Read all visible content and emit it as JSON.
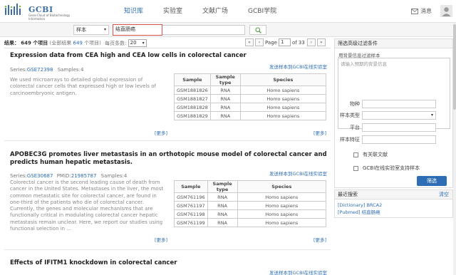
{
  "header": {
    "logo_title": "GCBI",
    "logo_sub": "Gene-Cloud of Biotechnology Information",
    "nav": [
      "知识库",
      "实验室",
      "文献广场",
      "GCBI学院"
    ],
    "active_nav": 0,
    "messages_label": "消息"
  },
  "search": {
    "type_value": "样本",
    "query": "结直肠癌"
  },
  "results": {
    "label": "结果：",
    "count_text": "649 个项目",
    "total_note_prefix": "(全部结果",
    "total_count": "649",
    "total_note_suffix": "个项目)",
    "per_page_label": "每页条数:",
    "per_page": "20",
    "pager": {
      "page_label": "Page",
      "page": "1",
      "of_label": "of 33"
    }
  },
  "items": [
    {
      "title": "Expression data from CEA high and CEA low cells in colorectal cancer",
      "send_label": "发送样本到GCBI在线实验室",
      "series_label": "Series:",
      "series_id": "GSE72398",
      "samples_label": "Samples:4",
      "pmid_label": "",
      "pmid": "",
      "desc": "We used microarrays to detailed global expression of colorectal cancer cells that expressed high or low levels of carcinoembryonic antigen.",
      "more_left": "[更多]",
      "more_right": "[更多]",
      "table_headers": [
        "Sample",
        "Sample type",
        "Species"
      ],
      "rows": [
        [
          "GSM1881826",
          "RNA",
          "Homo sapiens"
        ],
        [
          "GSM1881827",
          "RNA",
          "Homo sapiens"
        ],
        [
          "GSM1881828",
          "RNA",
          "Homo sapiens"
        ],
        [
          "GSM1881829",
          "RNA",
          "Homo sapiens"
        ]
      ]
    },
    {
      "title": "APOBEC3G promotes liver metastasis in an orthotopic mouse model of colorectal cancer and predicts human hepatic metastasis.",
      "send_label": "发送样本到GCBI在线实验室",
      "series_label": "Series:",
      "series_id": "GSE30687",
      "samples_label": "Samples:4",
      "pmid_label": "PMID:",
      "pmid": "21985787",
      "desc": "Colorectal cancer is the second leading cause of death from cancer in the United States. Metastases in the liver, the most common metastatic site for colorectal cancer, are found in one-third of the patients who die of colorectal cancer. Currently, the genes and molecular mechanisms that are functionally critical in modulating colorectal cancer hepatic metastasis remain unclear. Here, we report our studies using functional selection in ...",
      "more_left": "[更多]",
      "more_right": "[更多]",
      "table_headers": [
        "Sample",
        "Sample type",
        "Species"
      ],
      "rows": [
        [
          "GSM761196",
          "RNA",
          "Homo sapiens"
        ],
        [
          "GSM761197",
          "RNA",
          "Homo sapiens"
        ],
        [
          "GSM761198",
          "RNA",
          "Homo sapiens"
        ],
        [
          "GSM761199",
          "RNA",
          "Homo sapiens"
        ]
      ]
    },
    {
      "title": "Effects of IFITM1 knockdown in colorectal cancer",
      "send_label": "发送样本到GCBI在线实验室"
    }
  ],
  "filter_panel": {
    "title": "筛选高级过滤条件",
    "ta_label": "用背景信息过滤样本",
    "ta_placeholder": "请输入预期的背景信息",
    "fields": [
      {
        "label": "物种",
        "value": "",
        "dropdown": false
      },
      {
        "label": "样本类型",
        "value": "",
        "dropdown": true
      },
      {
        "label": "平台",
        "value": "",
        "dropdown": false
      },
      {
        "label": "样本特征",
        "value": "",
        "dropdown": false
      }
    ],
    "checkbox1": "有关联文献",
    "checkbox2": "GCBI在线实验室支持样本",
    "filter_button": "筛选"
  },
  "recent_panel": {
    "title": "最近搜索",
    "clear": "清空",
    "items": [
      "[Dictionary] BRCA2",
      "[Pubmed] 结直肠癌"
    ]
  },
  "colors": {
    "accent": "#2d6db5",
    "highlight_border": "#d9534f"
  }
}
